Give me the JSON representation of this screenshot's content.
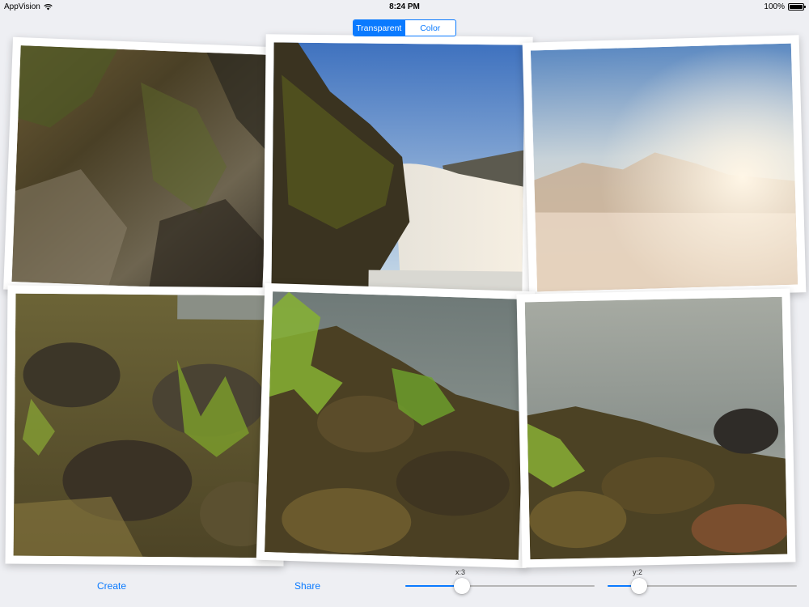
{
  "status_bar": {
    "carrier": "AppVision",
    "time": "8:24 PM",
    "battery": "100%"
  },
  "segmented": {
    "options": [
      "Transparent",
      "Color"
    ],
    "selected": "Transparent"
  },
  "collage": {
    "columns": 3,
    "rows": 2,
    "border_color": "#ffffff"
  },
  "toolbar": {
    "create_label": "Create",
    "share_label": "Share",
    "x_slider": {
      "label": "x:3",
      "value": 3
    },
    "y_slider": {
      "label": "y:2",
      "value": 2
    }
  },
  "colors": {
    "accent": "#0a7aff",
    "background": "#eeeff3"
  }
}
